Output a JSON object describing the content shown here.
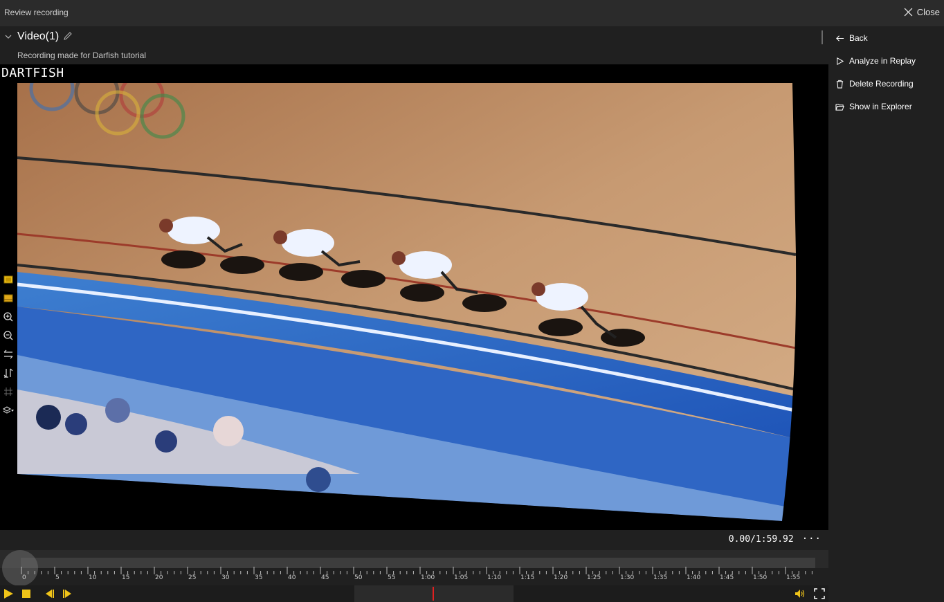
{
  "window": {
    "title": "Review recording",
    "close_label": "Close"
  },
  "video": {
    "title": "Video(1)",
    "description": "Recording made for Darfish tutorial",
    "watermark": "DARTFISH",
    "time_display": "0.00/1:59.92",
    "more_label": "···"
  },
  "sidebar": {
    "items": [
      {
        "label": "Back",
        "icon": "arrow-left-icon"
      },
      {
        "label": "Analyze in Replay",
        "icon": "play-outline-icon"
      },
      {
        "label": "Delete Recording",
        "icon": "trash-icon"
      },
      {
        "label": "Show in Explorer",
        "icon": "folder-open-icon"
      }
    ]
  },
  "tools": [
    "frame-view-icon",
    "overlay-view-icon",
    "zoom-in-icon",
    "zoom-out-icon",
    "flip-horizontal-icon",
    "flip-vertical-icon",
    "grid-icon",
    "layers-icon"
  ],
  "timeline": {
    "labels": [
      "0",
      "5",
      "10",
      "15",
      "20",
      "25",
      "30",
      "35",
      "40",
      "45",
      "50",
      "55",
      "1:00",
      "1:05",
      "1:10",
      "1:15",
      "1:20",
      "1:25",
      "1:30",
      "1:35",
      "1:40",
      "1:45",
      "1:50",
      "1:55"
    ],
    "progress": 0,
    "playhead_position": 0.5
  },
  "accent_color": "#f0c419",
  "playhead_color": "#e02020"
}
